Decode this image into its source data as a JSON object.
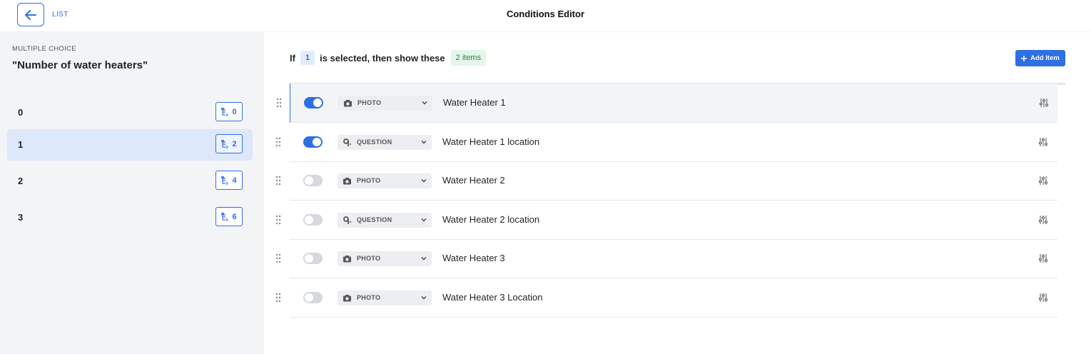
{
  "header": {
    "back_label": "LIST",
    "title": "Conditions Editor"
  },
  "sidebar": {
    "field_type": "MULTIPLE CHOICE",
    "field_name": "\"Number of water heaters\"",
    "choices": [
      {
        "label": "0",
        "count": "0",
        "active": false
      },
      {
        "label": "1",
        "count": "2",
        "active": true
      },
      {
        "label": "2",
        "count": "4",
        "active": false
      },
      {
        "label": "3",
        "count": "6",
        "active": false
      }
    ]
  },
  "condition": {
    "prefix": "If",
    "value": "1",
    "middle": "is selected, then show these",
    "count_text": "2 items"
  },
  "add_button": {
    "icon": "plus-icon",
    "label": "Add Item"
  },
  "items": [
    {
      "enabled": true,
      "type": "PHOTO",
      "type_icon": "camera-icon",
      "name": "Water Heater 1"
    },
    {
      "enabled": true,
      "type": "QUESTION",
      "type_icon": "question-icon",
      "name": "Water Heater 1 location"
    },
    {
      "enabled": false,
      "type": "PHOTO",
      "type_icon": "camera-icon",
      "name": "Water Heater 2"
    },
    {
      "enabled": false,
      "type": "QUESTION",
      "type_icon": "question-icon",
      "name": "Water Heater 2 location"
    },
    {
      "enabled": false,
      "type": "PHOTO",
      "type_icon": "camera-icon",
      "name": "Water Heater 3"
    },
    {
      "enabled": false,
      "type": "PHOTO",
      "type_icon": "camera-icon",
      "name": "Water Heater 3 Location"
    }
  ],
  "colors": {
    "accent": "#2f6fe4",
    "active_choice_bg": "#dde8fb",
    "count_badge_bg": "#e5f5ea",
    "count_badge_text": "#2e7d4a"
  }
}
